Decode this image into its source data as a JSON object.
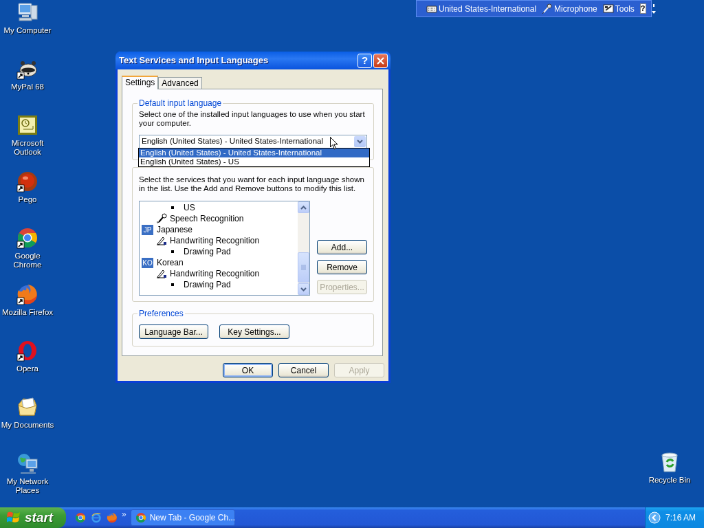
{
  "desktop_icons": [
    {
      "kind": "computer",
      "label": "My Computer",
      "shortcut": false
    },
    {
      "kind": "raccoon",
      "label": "MyPal 68",
      "shortcut": true
    },
    {
      "kind": "outlook",
      "label": "Microsoft Outlook",
      "shortcut": false
    },
    {
      "kind": "pego",
      "label": "Pego",
      "shortcut": true
    },
    {
      "kind": "chrome",
      "label": "Google Chrome",
      "shortcut": true
    },
    {
      "kind": "firefox",
      "label": "Mozilla Firefox",
      "shortcut": true
    },
    {
      "kind": "opera",
      "label": "Opera",
      "shortcut": true
    },
    {
      "kind": "documents",
      "label": "My Documents",
      "shortcut": false
    },
    {
      "kind": "network",
      "label": "My Network Places",
      "shortcut": false
    }
  ],
  "recycle_bin": {
    "label": "Recycle Bin"
  },
  "language_bar": {
    "items": [
      {
        "kind": "keyboard",
        "label": "United States-International"
      },
      {
        "kind": "microphone",
        "label": "Microphone"
      },
      {
        "kind": "tools",
        "label": "Tools"
      }
    ],
    "help_glyph": "?"
  },
  "dialog": {
    "title": "Text Services and Input Languages",
    "help_glyph": "?",
    "tabs": [
      {
        "label": "Settings",
        "selected": true
      },
      {
        "label": "Advanced",
        "selected": false
      }
    ],
    "default_group": {
      "legend": "Default input language",
      "description": "Select one of the installed input languages to use when you start your computer.",
      "combo_value": "English (United States) - United States-International",
      "dropdown_options": [
        {
          "label": "English (United States) - United States-International",
          "selected": true
        },
        {
          "label": "English (United States) - US",
          "selected": false
        }
      ]
    },
    "services_group": {
      "description": "Select the services that you want for each input language shown in the list. Use the Add and Remove buttons to modify this list.",
      "tree": [
        {
          "kind": "layout",
          "label": "US"
        },
        {
          "kind": "speech",
          "label": "Speech Recognition"
        },
        {
          "kind": "language",
          "badge": "JP",
          "label": "Japanese",
          "children": [
            {
              "kind": "handwriting",
              "label": "Handwriting Recognition",
              "children": [
                {
                  "kind": "layout",
                  "label": "Drawing Pad"
                }
              ]
            }
          ]
        },
        {
          "kind": "language",
          "badge": "KO",
          "label": "Korean",
          "children": [
            {
              "kind": "handwriting",
              "label": "Handwriting Recognition",
              "children": [
                {
                  "kind": "layout",
                  "label": "Drawing Pad"
                }
              ]
            }
          ]
        }
      ],
      "buttons": [
        {
          "label": "Add...",
          "disabled": false
        },
        {
          "label": "Remove",
          "disabled": false
        },
        {
          "label": "Properties...",
          "disabled": true
        }
      ]
    },
    "preferences_group": {
      "legend": "Preferences",
      "buttons": [
        {
          "label": "Language Bar..."
        },
        {
          "label": "Key Settings..."
        }
      ]
    },
    "footer_buttons": [
      {
        "label": "OK",
        "disabled": false,
        "default": true
      },
      {
        "label": "Cancel",
        "disabled": false,
        "default": false
      },
      {
        "label": "Apply",
        "disabled": true,
        "default": false
      }
    ]
  },
  "taskbar": {
    "start_label": "start",
    "quick_launch": [
      {
        "kind": "chrome"
      },
      {
        "kind": "ie"
      },
      {
        "kind": "firefox"
      }
    ],
    "chevron": "»",
    "tasks": [
      {
        "label": "New Tab - Google Ch...",
        "selected": false
      }
    ],
    "clock": "7:16 AM"
  }
}
